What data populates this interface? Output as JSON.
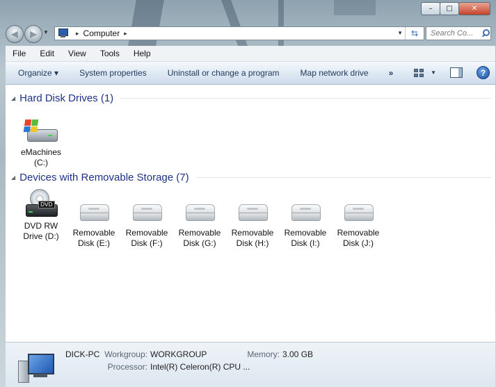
{
  "window": {
    "controls": {
      "minimize": "–",
      "maximize": "□",
      "close": "✕"
    }
  },
  "nav": {
    "back_glyph": "◀",
    "forward_glyph": "▶",
    "breadcrumb_sep_1": "▸",
    "breadcrumb_location": "Computer",
    "breadcrumb_sep_2": "▸",
    "address_dropdown_glyph": "▼",
    "refresh_glyph": "⇆",
    "search_placeholder": "Search Co..."
  },
  "menubar": {
    "items": [
      "File",
      "Edit",
      "View",
      "Tools",
      "Help"
    ]
  },
  "commandbar": {
    "organize": "Organize ▾",
    "system_properties": "System properties",
    "uninstall": "Uninstall or change a program",
    "map_drive": "Map network drive",
    "more": "»",
    "views_drop": "▼",
    "help": "?"
  },
  "groups": {
    "hard_disks": {
      "collapse_glyph": "◢",
      "title": "Hard Disk Drives (1)",
      "drives": [
        {
          "line1": "eMachines",
          "line2": "(C:)",
          "icon": "windows-hard-disk-icon"
        }
      ]
    },
    "removable": {
      "collapse_glyph": "◢",
      "title": "Devices with Removable Storage (7)",
      "drives": [
        {
          "line1": "DVD RW",
          "line2": "Drive (D:)",
          "icon": "dvd-drive-icon",
          "badge": "DVD"
        },
        {
          "line1": "Removable",
          "line2": "Disk (E:)",
          "icon": "removable-disk-icon"
        },
        {
          "line1": "Removable",
          "line2": "Disk (F:)",
          "icon": "removable-disk-icon"
        },
        {
          "line1": "Removable",
          "line2": "Disk (G:)",
          "icon": "removable-disk-icon"
        },
        {
          "line1": "Removable",
          "line2": "Disk (H:)",
          "icon": "removable-disk-icon"
        },
        {
          "line1": "Removable",
          "line2": "Disk (I:)",
          "icon": "removable-disk-icon"
        },
        {
          "line1": "Removable",
          "line2": "Disk (J:)",
          "icon": "removable-disk-icon"
        }
      ]
    }
  },
  "details": {
    "computer_name": "DICK-PC",
    "workgroup_label": "Workgroup:",
    "workgroup_value": "WORKGROUP",
    "memory_label": "Memory:",
    "memory_value": "3.00 GB",
    "processor_label": "Processor:",
    "processor_value": "Intel(R) Celeron(R) CPU ..."
  },
  "colors": {
    "group_title": "#1e3287",
    "command_text": "#1e395b",
    "content_bg": "#ffffff"
  }
}
